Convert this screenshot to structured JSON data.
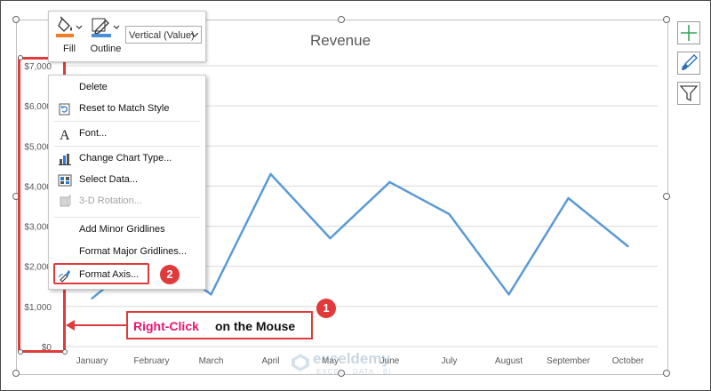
{
  "chart": {
    "title": "Revenue"
  },
  "chart_data": {
    "type": "line",
    "title": "Revenue",
    "categories": [
      "January",
      "February",
      "March",
      "April",
      "May",
      "June",
      "July",
      "August",
      "September",
      "October"
    ],
    "series": [
      {
        "values": [
          1200,
          2400,
          1300,
          4300,
          2700,
          4100,
          3300,
          1300,
          3700,
          2500
        ]
      }
    ],
    "y_ticks": [
      "$0",
      "$1,000",
      "$2,000",
      "$3,000",
      "$4,000",
      "$5,000",
      "$6,000",
      "$7,000"
    ],
    "ylim": [
      0,
      7000
    ],
    "grid": true,
    "line_color": "#5b9bd5",
    "legend": "none"
  },
  "mini_toolbar": {
    "fill_label": "Fill",
    "outline_label": "Outline",
    "element_select": "Vertical (Value)"
  },
  "context_menu": {
    "items": [
      {
        "label": "Delete",
        "icon": "none",
        "enabled": true
      },
      {
        "label": "Reset to Match Style",
        "icon": "reset-style-icon",
        "enabled": true
      },
      {
        "label": "Font...",
        "icon": "font-icon",
        "enabled": true
      },
      {
        "label": "Change Chart Type...",
        "icon": "chart-type-icon",
        "enabled": true
      },
      {
        "label": "Select Data...",
        "icon": "select-data-icon",
        "enabled": true
      },
      {
        "label": "3-D Rotation...",
        "icon": "rotation-icon",
        "enabled": false
      },
      {
        "label": "Add Minor Gridlines",
        "icon": "none",
        "enabled": true
      },
      {
        "label": "Format Major Gridlines...",
        "icon": "none",
        "enabled": true
      },
      {
        "label": "Format Axis...",
        "icon": "format-axis-icon",
        "enabled": true
      }
    ]
  },
  "annotations": {
    "step1": "1",
    "step2": "2",
    "callout_part1": "Right-Click",
    "callout_part2": "on the Mouse",
    "highlight_color": "#e03a3a"
  },
  "side_buttons": [
    {
      "icon": "plus-icon"
    },
    {
      "icon": "brush-icon"
    },
    {
      "icon": "filter-icon"
    }
  ],
  "watermark": {
    "name": "exceldemy",
    "tagline": "EXCEL · DATA · BI"
  }
}
